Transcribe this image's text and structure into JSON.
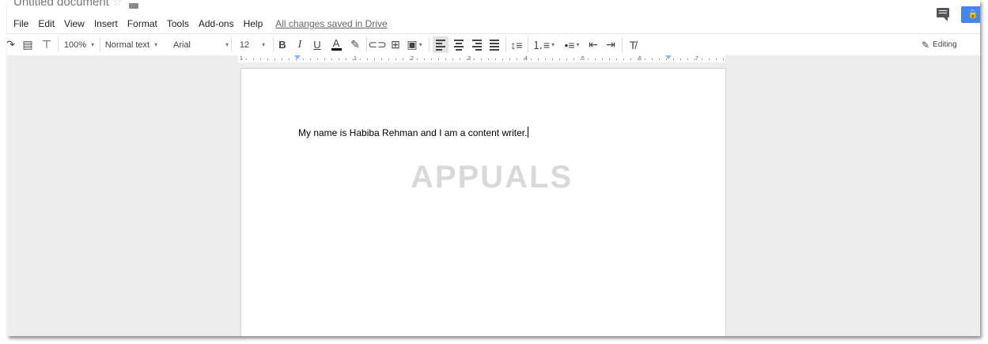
{
  "header": {
    "doc_title": "Untitled document",
    "save_status": "All changes saved in Drive",
    "menu": [
      "File",
      "Edit",
      "View",
      "Insert",
      "Format",
      "Tools",
      "Add-ons",
      "Help"
    ]
  },
  "toolbar": {
    "zoom": "100%",
    "style": "Normal text",
    "font": "Arial",
    "size": "12",
    "bold": "B",
    "italic": "I",
    "underline": "U",
    "text_color": "A",
    "mode": "Editing"
  },
  "ruler": {
    "numbers": [
      "1",
      "1",
      "2",
      "3",
      "4",
      "5",
      "6",
      "7"
    ]
  },
  "document": {
    "text": "My name is Habiba Rehman and I am a content writer.",
    "watermark": "APPUALS"
  },
  "colors": {
    "accent": "#4285f4",
    "background": "#ededed"
  }
}
